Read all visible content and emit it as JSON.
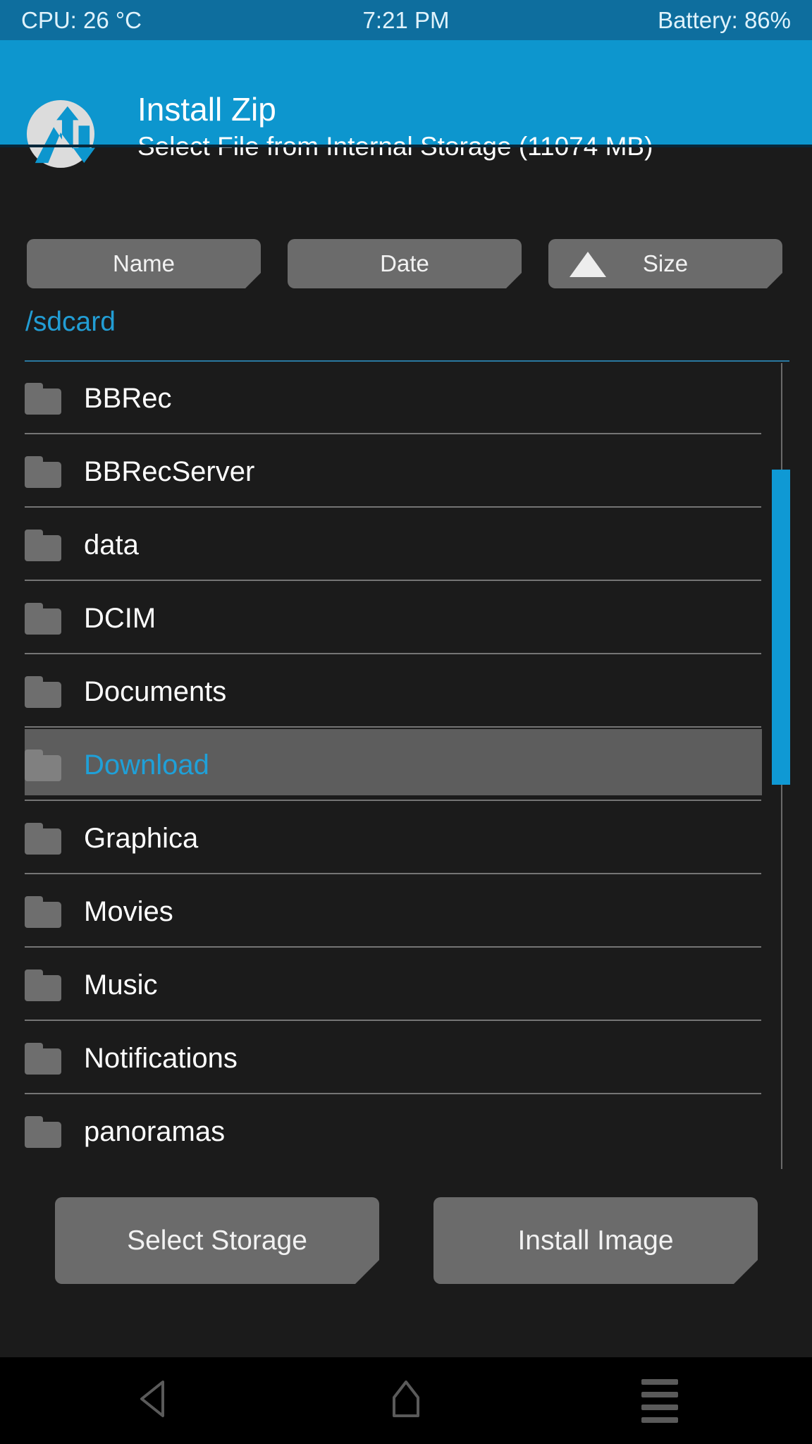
{
  "colors": {
    "statusbar_bg": "#0e6e9e",
    "header_bg": "#0d96ce",
    "page_bg": "#1b1b1b",
    "accent_blue": "#1fa0d8",
    "path_blue": "#229dd4",
    "button_gray": "#6b6b6b",
    "selected_row": "#5d5d5d",
    "scrollbar_thumb": "#0f99d4",
    "folder_icon": "#6e6e6e",
    "divider": "#757575",
    "text_primary": "#fefefe",
    "navbar_bg": "#000000",
    "navbar_icon": "#5a5a5a"
  },
  "statusbar": {
    "cpu": "CPU: 26 °C",
    "clock": "7:21 PM",
    "battery": "Battery: 86%"
  },
  "header": {
    "logo_icon": "twrp-logo-icon",
    "title": "Install Zip",
    "subtitle": "Select File from Internal Storage (11074 MB)"
  },
  "sort": {
    "buttons": [
      {
        "label": "Name",
        "active": false,
        "icon": null
      },
      {
        "label": "Date",
        "active": false,
        "icon": null
      },
      {
        "label": "Size",
        "active": true,
        "icon": "triangle-up-icon"
      }
    ]
  },
  "path": {
    "current": "/sdcard"
  },
  "filelist": {
    "items": [
      {
        "name": "BBRec",
        "icon": "folder-icon",
        "selected": false
      },
      {
        "name": "BBRecServer",
        "icon": "folder-icon",
        "selected": false
      },
      {
        "name": "data",
        "icon": "folder-icon",
        "selected": false
      },
      {
        "name": "DCIM",
        "icon": "folder-icon",
        "selected": false
      },
      {
        "name": "Documents",
        "icon": "folder-icon",
        "selected": false
      },
      {
        "name": "Download",
        "icon": "folder-icon",
        "selected": true
      },
      {
        "name": "Graphica",
        "icon": "folder-icon",
        "selected": false
      },
      {
        "name": "Movies",
        "icon": "folder-icon",
        "selected": false
      },
      {
        "name": "Music",
        "icon": "folder-icon",
        "selected": false
      },
      {
        "name": "Notifications",
        "icon": "folder-icon",
        "selected": false
      },
      {
        "name": "panoramas",
        "icon": "folder-icon",
        "selected": false
      }
    ]
  },
  "scrollbar": {
    "orientation": "vertical",
    "thumb_position_percent": 13,
    "thumb_size_percent": 39
  },
  "actions": {
    "select_storage_label": "Select Storage",
    "install_image_label": "Install Image"
  },
  "navbar": {
    "back_icon": "back-triangle-icon",
    "home_icon": "home-icon",
    "menu_icon": "menu-lines-icon"
  }
}
